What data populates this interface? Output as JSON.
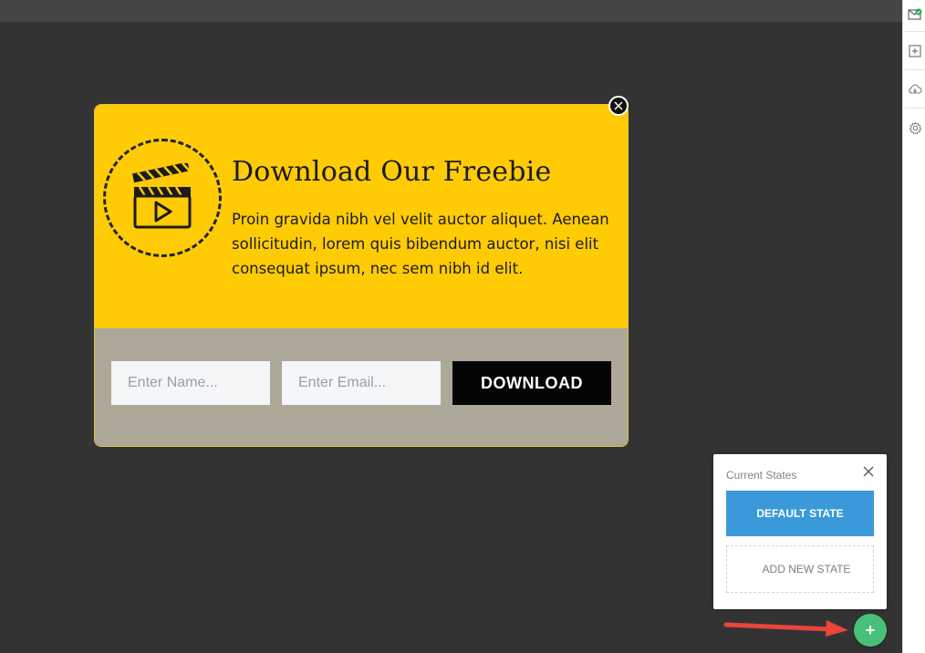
{
  "popup": {
    "title": "Download Our Freebie",
    "description": "Proin gravida nibh vel velit auctor aliquet. Aenean sollicitudin, lorem quis bibendum auctor, nisi elit consequat ipsum, nec sem nibh id elit.",
    "name_placeholder": "Enter Name...",
    "email_placeholder": "Enter Email...",
    "download_label": "DOWNLOAD",
    "colors": {
      "top": "#ffcb05",
      "bottom": "#ada898",
      "button": "#050505"
    }
  },
  "states_panel": {
    "title": "Current States",
    "default_state_label": "DEFAULT STATE",
    "add_state_label": "ADD NEW STATE"
  },
  "fab": {
    "label": "+",
    "color": "#47c07a"
  },
  "toolbar": {
    "icons": [
      "envelope-check-icon",
      "add-box-icon",
      "cloud-download-icon",
      "gear-icon"
    ]
  }
}
